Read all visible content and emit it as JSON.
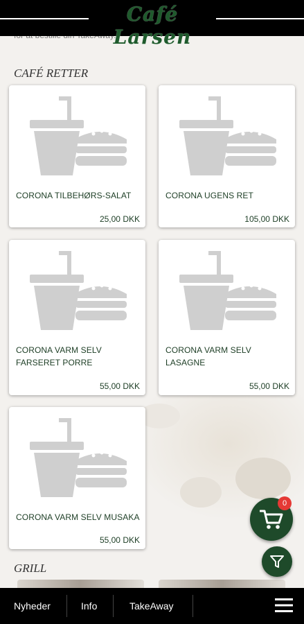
{
  "header": {
    "logo_text": "Café Larsen"
  },
  "intro": {
    "cut_text": "for at bestille din TakeAway."
  },
  "sections": [
    {
      "title": "CAFÉ RETTER",
      "items": [
        {
          "name": "CORONA TILBEHØRS-SALAT",
          "price": "25,00 DKK",
          "icon": "drink-burger-placeholder-icon"
        },
        {
          "name": "CORONA UGENS RET",
          "price": "105,00 DKK",
          "icon": "drink-burger-placeholder-icon"
        },
        {
          "name": "CORONA VARM SELV FARSERET PORRE",
          "price": "55,00 DKK",
          "icon": "drink-burger-placeholder-icon"
        },
        {
          "name": "CORONA VARM SELV LASAGNE",
          "price": "55,00 DKK",
          "icon": "drink-burger-placeholder-icon"
        },
        {
          "name": "CORONA VARM SELV MUSAKA",
          "price": "55,00 DKK",
          "icon": "drink-burger-placeholder-icon"
        }
      ]
    },
    {
      "title": "GRILL",
      "items": []
    }
  ],
  "cart": {
    "count": "0",
    "icon": "shopping-cart-icon"
  },
  "filter": {
    "icon": "filter-icon"
  },
  "bottom_nav": {
    "items": [
      "Nyheder",
      "Info",
      "TakeAway"
    ],
    "menu_icon": "hamburger-menu-icon"
  },
  "colors": {
    "brand_green": "#1e4a2a",
    "header_bg": "#000000",
    "badge": "#e53935"
  }
}
